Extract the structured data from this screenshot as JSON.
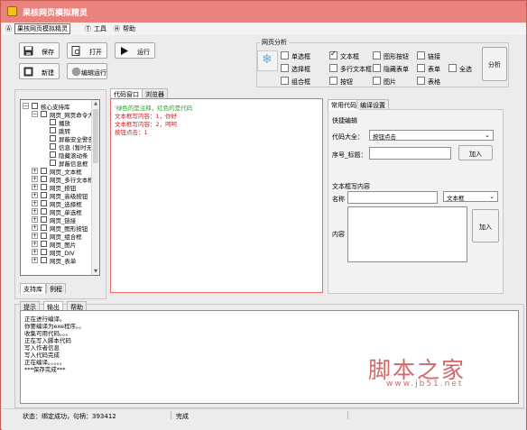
{
  "window": {
    "title": "果核网页模拟精灵"
  },
  "menubar": {
    "items": [
      "果核网页模拟精灵",
      "工具",
      "帮助"
    ]
  },
  "toolbar": {
    "save": "保存",
    "open": "打开",
    "run": "运行",
    "new": "新建",
    "edit_run": "编辑运行"
  },
  "analysis": {
    "title": "网页分析",
    "checkboxes": [
      {
        "label": "单选框",
        "checked": false
      },
      {
        "label": "选择框",
        "checked": false
      },
      {
        "label": "组合框",
        "checked": false
      },
      {
        "label": "文本框",
        "checked": true
      },
      {
        "label": "多行文本框",
        "checked": false
      },
      {
        "label": "按钮",
        "checked": false
      },
      {
        "label": "图形按钮",
        "checked": false
      },
      {
        "label": "隐藏表单",
        "checked": false
      },
      {
        "label": "图片",
        "checked": false
      },
      {
        "label": "链接",
        "checked": false
      },
      {
        "label": "表单",
        "checked": false
      },
      {
        "label": "表格",
        "checked": false
      },
      {
        "label": "全选",
        "checked": false
      }
    ],
    "analyze_button": "分析"
  },
  "tree": {
    "rows": [
      {
        "level": 0,
        "expander": "−",
        "label": "核心支持库"
      },
      {
        "level": 1,
        "expander": "−",
        "label": "网页_网页命令大全"
      },
      {
        "level": 2,
        "expander": "",
        "label": "播放"
      },
      {
        "level": 2,
        "expander": "",
        "label": "跳转"
      },
      {
        "level": 2,
        "expander": "",
        "label": "屏蔽安全警告"
      },
      {
        "level": 2,
        "expander": "",
        "label": "信息 (暂时无用"
      },
      {
        "level": 2,
        "expander": "",
        "label": "隐藏滚动条"
      },
      {
        "level": 2,
        "expander": "",
        "label": "屏蔽信息框"
      },
      {
        "level": 1,
        "expander": "+",
        "label": "网页_文本框"
      },
      {
        "level": 1,
        "expander": "+",
        "label": "网页_多行文本框"
      },
      {
        "level": 1,
        "expander": "+",
        "label": "网页_按钮"
      },
      {
        "level": 1,
        "expander": "+",
        "label": "网页_高级按钮"
      },
      {
        "level": 1,
        "expander": "+",
        "label": "网页_选择框"
      },
      {
        "level": 1,
        "expander": "+",
        "label": "网页_单选框"
      },
      {
        "level": 1,
        "expander": "+",
        "label": "网页_链接"
      },
      {
        "level": 1,
        "expander": "+",
        "label": "网页_图形按钮"
      },
      {
        "level": 1,
        "expander": "+",
        "label": "网页_组合框"
      },
      {
        "level": 1,
        "expander": "+",
        "label": "网页_图片"
      },
      {
        "level": 1,
        "expander": "+",
        "label": "网页_DIV"
      },
      {
        "level": 1,
        "expander": "+",
        "label": "网页_表单"
      }
    ],
    "tabs": [
      "支持库",
      "例程"
    ]
  },
  "code_tabs": [
    "代码窗口",
    "浏览器"
  ],
  "code_lines": [
    {
      "text": "'绿色的是注释，红色的是代码",
      "color": "#2e9b2e"
    },
    {
      "text": "文本框写内容：1，你好",
      "color": "#c81e1e"
    },
    {
      "text": "文本框写内容：2，呵呵",
      "color": "#c81e1e"
    },
    {
      "text": "按钮点击：1",
      "color": "#c81e1e"
    }
  ],
  "right_tabs": [
    "常用代码",
    "编译设置"
  ],
  "quick": {
    "title": "快捷编辑",
    "code_label": "代码大全：",
    "code_value": "按钮点击",
    "index_label": "序号_标题：",
    "add_button": "加入"
  },
  "textbox_write": {
    "title": "文本框写内容",
    "name_label": "名称",
    "type_value": "文本框",
    "content_label": "内容",
    "add_button": "加入"
  },
  "log_tabs": [
    "提示",
    "输出",
    "帮助"
  ],
  "log_lines": [
    "正在进行编译。",
    "你要编译为exe程序。。",
    "收集可用代码。。。",
    "正在写入脚本代码",
    "写入作者信息",
    "写入代码完成",
    "正在编译。。。。。",
    "***保存完成***"
  ],
  "status": {
    "left": "状态：绑定成功，句柄：393412",
    "middle": "完成"
  },
  "watermark": {
    "cn": "脚本之家",
    "url": "www.jb51.net"
  }
}
